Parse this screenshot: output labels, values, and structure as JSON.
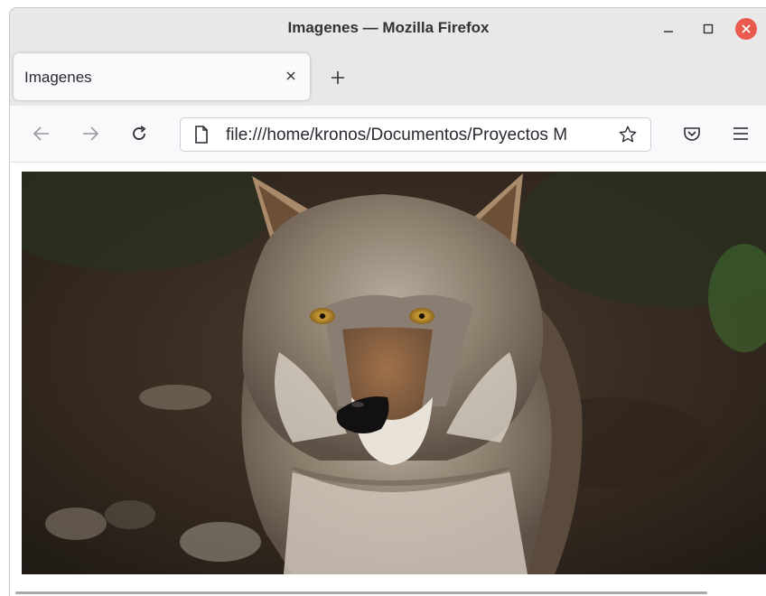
{
  "window": {
    "title": "Imagenes — Mozilla Firefox"
  },
  "tabs": [
    {
      "label": "Imagenes",
      "active": true
    }
  ],
  "navbar": {
    "url": "file:///home/kronos/Documentos/Proyectos M",
    "icons": {
      "back": "arrow-left-icon",
      "forward": "arrow-right-icon",
      "reload": "reload-icon",
      "page": "page-icon",
      "bookmark": "star-icon",
      "pocket": "pocket-icon",
      "menu": "hamburger-menu-icon"
    }
  },
  "content": {
    "image_subject": "wolf",
    "image_alt": ""
  },
  "colors": {
    "titlebar": "#e8e8e8",
    "close_button": "#e95b4f",
    "toolbar": "#f9f9fb"
  }
}
